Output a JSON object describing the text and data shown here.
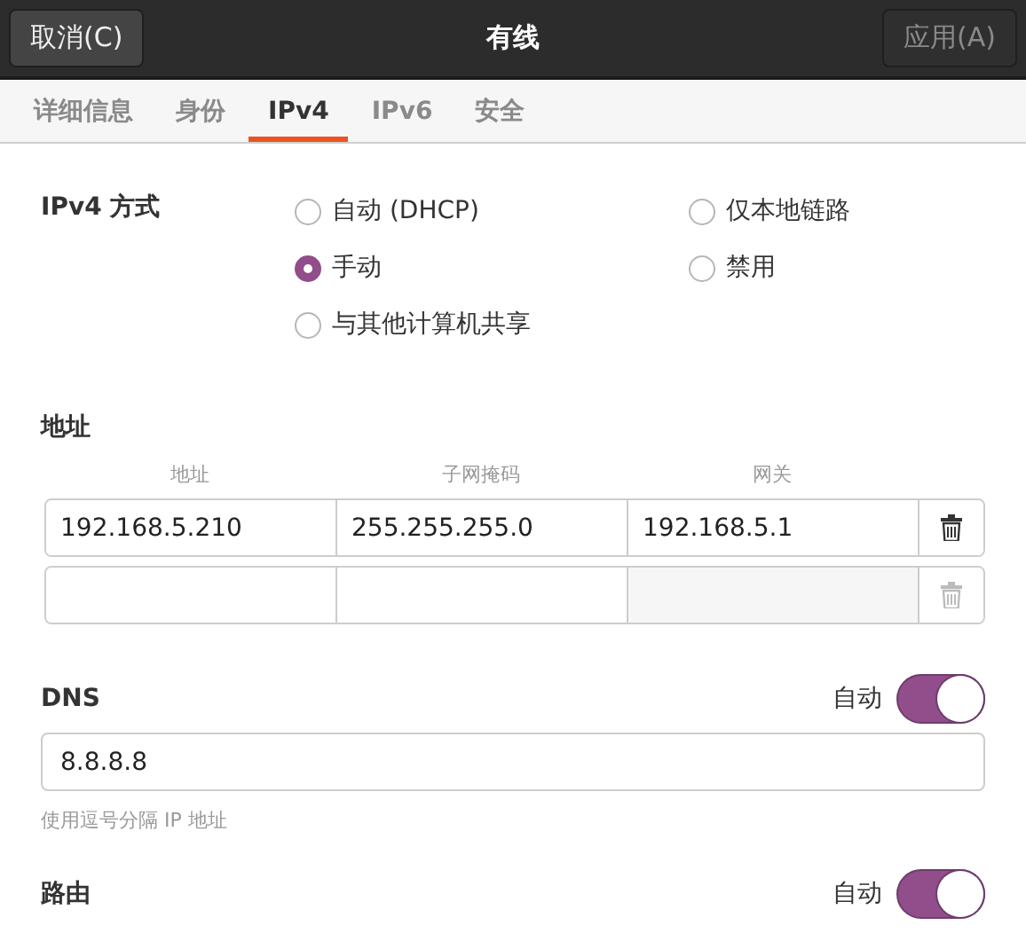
{
  "window": {
    "title": "有线",
    "cancel_button": "取消(C)",
    "apply_button": {
      "label": "应用(A)",
      "disabled": true
    }
  },
  "tabs": [
    {
      "label": "详细信息",
      "selected": false
    },
    {
      "label": "身份",
      "selected": false
    },
    {
      "label": "IPv4",
      "selected": true
    },
    {
      "label": "IPv6",
      "selected": false
    },
    {
      "label": "安全",
      "selected": false
    }
  ],
  "method": {
    "label": "IPv4 方式",
    "options": [
      {
        "label": "自动 (DHCP)",
        "selected": false
      },
      {
        "label": "仅本地链路",
        "selected": false
      },
      {
        "label": "手动",
        "selected": true
      },
      {
        "label": "禁用",
        "selected": false
      },
      {
        "label": "与其他计算机共享",
        "selected": false
      }
    ]
  },
  "addresses": {
    "title": "地址",
    "columns": [
      "地址",
      "子网掩码",
      "网关"
    ],
    "rows": [
      {
        "address": "192.168.5.210",
        "netmask": "255.255.255.0",
        "gateway": "192.168.5.1",
        "removable": true
      },
      {
        "removable": false
      }
    ]
  },
  "dns": {
    "title": "DNS",
    "auto_label": "自动",
    "auto": true,
    "value": "8.8.8.8",
    "hint": "使用逗号分隔 IP 地址"
  },
  "routes": {
    "title": "路由",
    "auto_label": "自动",
    "auto": true
  }
}
